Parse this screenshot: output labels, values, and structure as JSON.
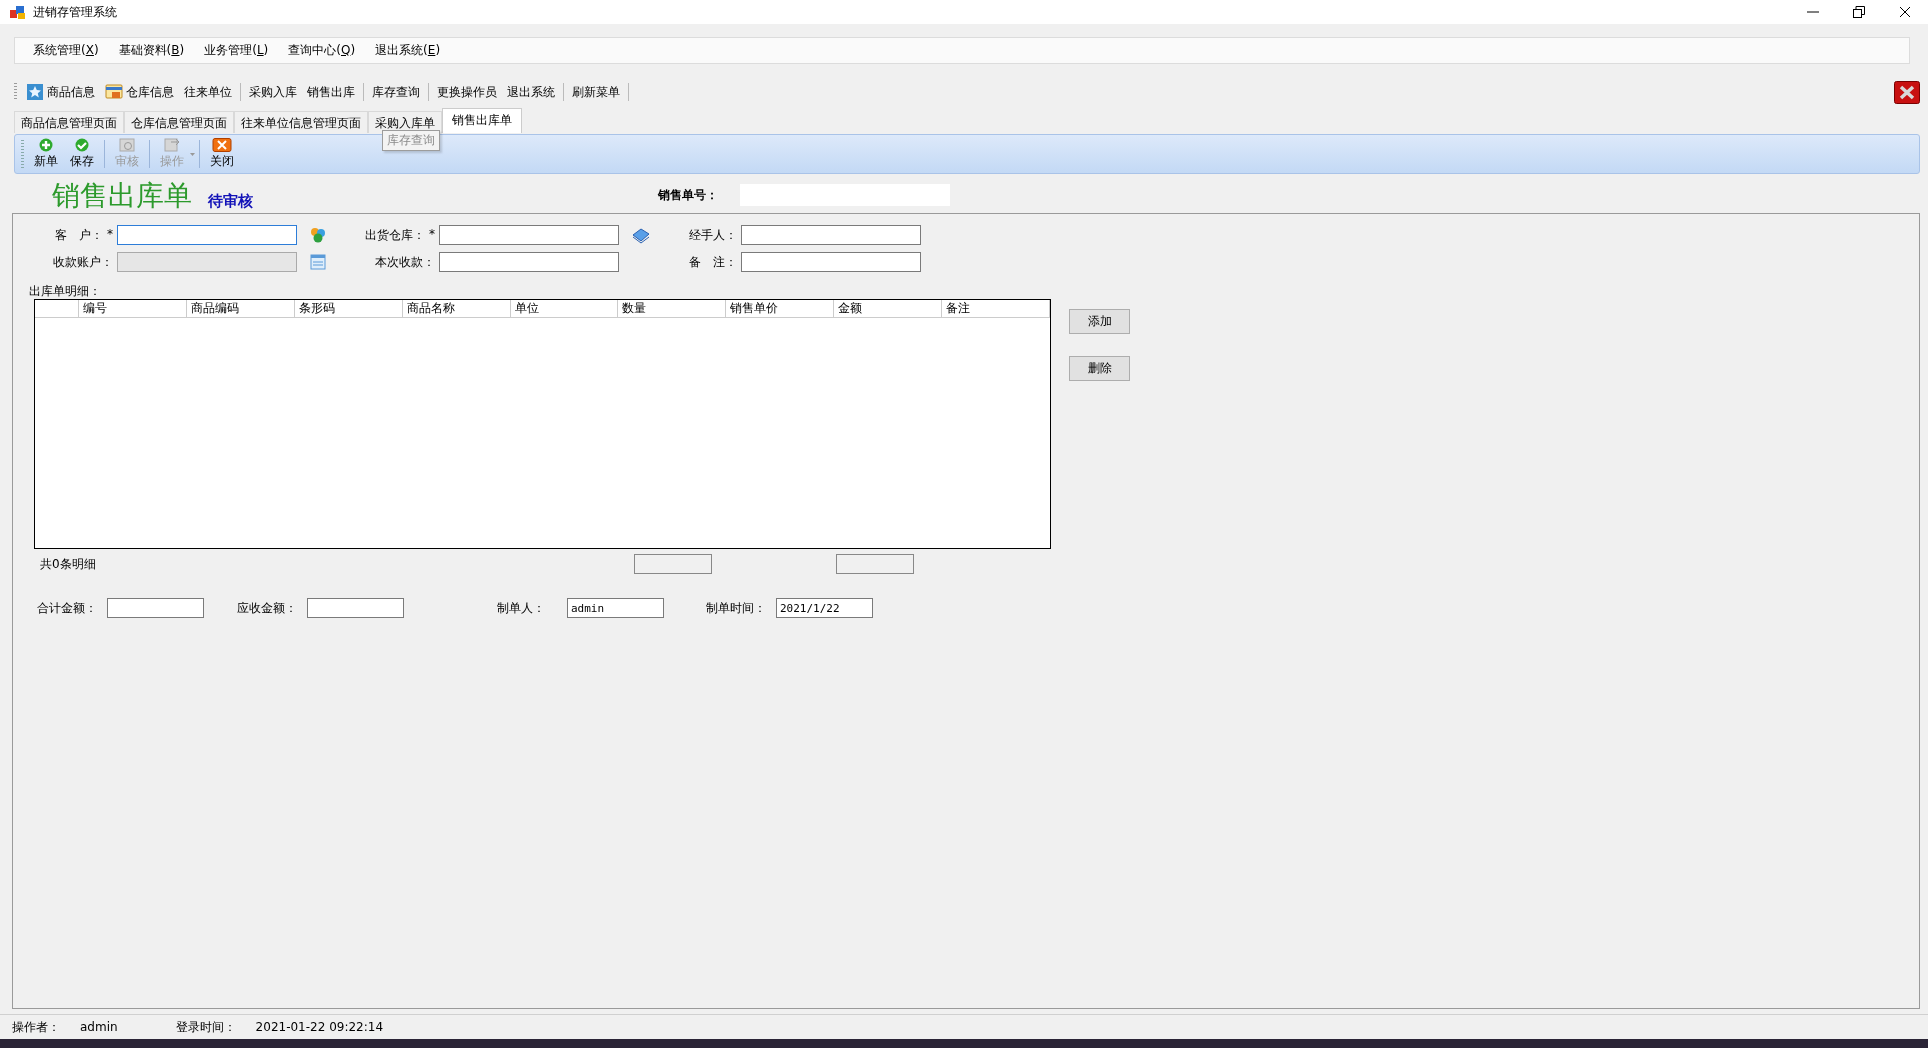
{
  "window": {
    "title": "进销存管理系统"
  },
  "menu": [
    "系统管理(X)",
    "基础资料(B)",
    "业务管理(L)",
    "查询中心(Q)",
    "退出系统(E)"
  ],
  "toolbar": [
    [
      {
        "label": "商品信息",
        "kind": "goods"
      },
      {
        "label": "仓库信息",
        "kind": "store"
      },
      {
        "label": "往来单位",
        "kind": "text"
      }
    ],
    [
      {
        "label": "采购入库",
        "kind": "text"
      },
      {
        "label": "销售出库",
        "kind": "text"
      }
    ],
    [
      {
        "label": "库存查询",
        "kind": "text"
      }
    ],
    [
      {
        "label": "更换操作员",
        "kind": "text"
      },
      {
        "label": "退出系统",
        "kind": "text"
      }
    ],
    [
      {
        "label": "刷新菜单",
        "kind": "text"
      }
    ]
  ],
  "tabs": [
    {
      "label": "商品信息管理页面",
      "selected": false
    },
    {
      "label": "仓库信息管理页面",
      "selected": false
    },
    {
      "label": "往来单位信息管理页面",
      "selected": false
    },
    {
      "label": "采购入库单",
      "selected": false
    },
    {
      "label": "销售出库单",
      "selected": true
    }
  ],
  "tooltip": "库存查询",
  "actions": [
    {
      "label": "新单",
      "kind": "add",
      "disabled": false
    },
    {
      "label": "保存",
      "kind": "save",
      "disabled": false
    },
    {
      "label": "审核",
      "kind": "audit",
      "disabled": true
    },
    {
      "label": "操作",
      "kind": "operate",
      "disabled": true
    },
    {
      "label": "关闭",
      "kind": "close",
      "disabled": false
    }
  ],
  "form": {
    "title": "销售出库单",
    "status": "待审核",
    "order_no": {
      "label": "销售单号："
    },
    "fields": [
      [
        {
          "label": "客　户：",
          "mark": "*",
          "focused": true,
          "disabled": false,
          "kind": "people"
        },
        {
          "label": "出货仓库：",
          "mark": "*",
          "focused": false,
          "disabled": false,
          "kind": "book"
        },
        {
          "label": "经手人：",
          "focused": false,
          "disabled": false,
          "kind": "plain"
        }
      ],
      [
        {
          "label": "收款账户：",
          "focused": false,
          "disabled": true,
          "kind": "list"
        },
        {
          "label": "本次收款：",
          "focused": false,
          "disabled": false,
          "kind": "plain"
        },
        {
          "label": "备　注：",
          "focused": false,
          "disabled": false,
          "kind": "plain"
        }
      ]
    ],
    "detail_label": "出库单明细：",
    "columns": [
      "编号",
      "商品编码",
      "条形码",
      "商品名称",
      "单位",
      "数量",
      "销售单价",
      "金额",
      "备注"
    ],
    "buttons": [
      "添加",
      "删除"
    ],
    "count": "共0条明细",
    "footer": [
      {
        "label": "合计金额："
      },
      {
        "label": "应收金额："
      },
      {
        "label": "制单人：",
        "value": "admin"
      },
      {
        "label": "制单时间：",
        "value": "2021/1/22"
      }
    ]
  },
  "status_bar": [
    {
      "label": "操作者：",
      "value": "admin"
    },
    {
      "label": "登录时间：",
      "value": "2021-01-22 09:22:14"
    }
  ]
}
